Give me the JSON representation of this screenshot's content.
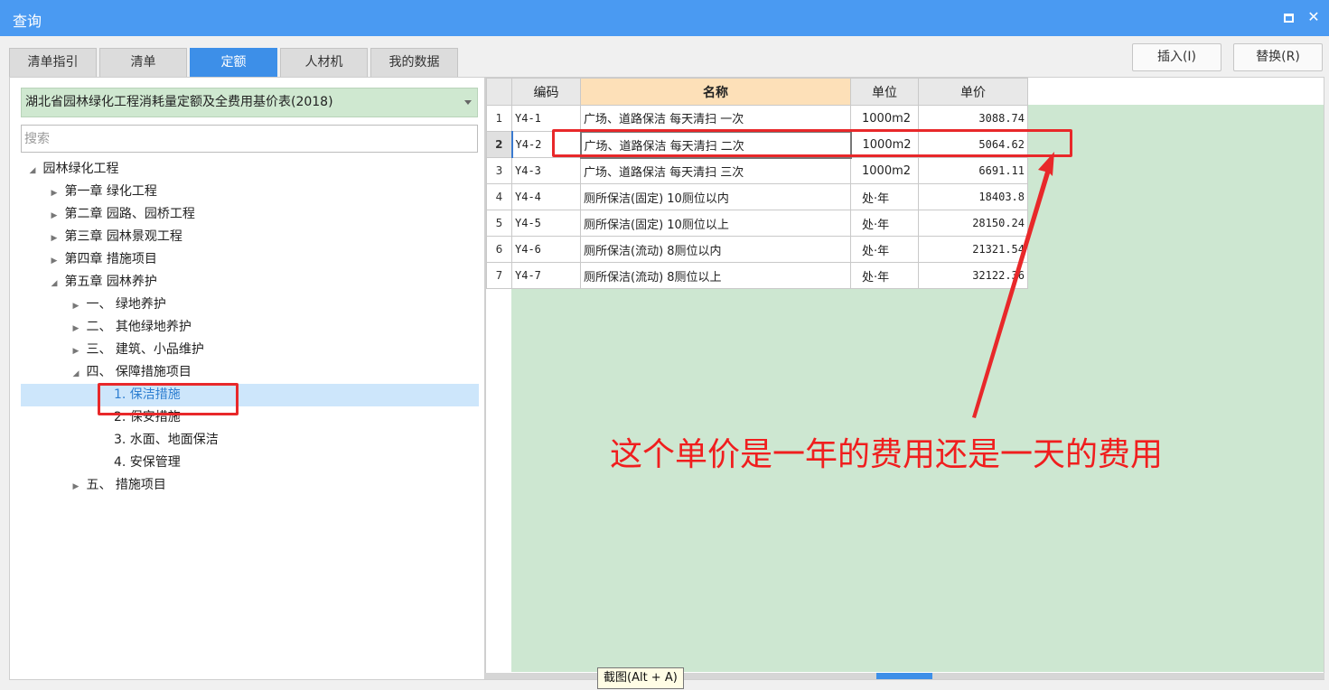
{
  "window": {
    "title": "查询"
  },
  "tabs": [
    {
      "label": "清单指引",
      "active": false
    },
    {
      "label": "清单",
      "active": false
    },
    {
      "label": "定额",
      "active": true
    },
    {
      "label": "人材机",
      "active": false
    },
    {
      "label": "我的数据",
      "active": false
    }
  ],
  "actions": {
    "insert_label": "插入(I)",
    "replace_label": "替换(R)"
  },
  "library": {
    "selected": "湖北省园林绿化工程消耗量定额及全费用基价表(2018)"
  },
  "search": {
    "placeholder": "搜索"
  },
  "tree": [
    {
      "label": "园林绿化工程",
      "expanded": true
    },
    {
      "label": "第一章 绿化工程",
      "expanded": false
    },
    {
      "label": "第二章 园路、园桥工程",
      "expanded": false
    },
    {
      "label": "第三章 园林景观工程",
      "expanded": false
    },
    {
      "label": "第四章 措施项目",
      "expanded": false
    },
    {
      "label": "第五章 园林养护",
      "expanded": true
    },
    {
      "label": "一、  绿地养护",
      "expanded": false
    },
    {
      "label": "二、  其他绿地养护",
      "expanded": false
    },
    {
      "label": "三、  建筑、小品维护",
      "expanded": false
    },
    {
      "label": "四、  保障措施项目",
      "expanded": true
    },
    {
      "label": "1. 保洁措施",
      "selected": true
    },
    {
      "label": "2. 保安措施"
    },
    {
      "label": "3. 水面、地面保洁"
    },
    {
      "label": "4. 安保管理"
    },
    {
      "label": "五、  措施项目",
      "expanded": false
    }
  ],
  "grid": {
    "columns": [
      "编码",
      "名称",
      "单位",
      "单价"
    ],
    "rows": [
      {
        "num": "1",
        "code": "Y4-1",
        "name": "广场、道路保洁 每天清扫 一次",
        "unit": "1000m2",
        "price": "3088.74"
      },
      {
        "num": "2",
        "code": "Y4-2",
        "name": "广场、道路保洁 每天清扫 二次",
        "unit": "1000m2",
        "price": "5064.62"
      },
      {
        "num": "3",
        "code": "Y4-3",
        "name": "广场、道路保洁 每天清扫 三次",
        "unit": "1000m2",
        "price": "6691.11"
      },
      {
        "num": "4",
        "code": "Y4-4",
        "name": "厕所保洁(固定) 10厕位以内",
        "unit": "处·年",
        "price": "18403.8"
      },
      {
        "num": "5",
        "code": "Y4-5",
        "name": "厕所保洁(固定) 10厕位以上",
        "unit": "处·年",
        "price": "28150.24"
      },
      {
        "num": "6",
        "code": "Y4-6",
        "name": "厕所保洁(流动) 8厕位以内",
        "unit": "处·年",
        "price": "21321.54"
      },
      {
        "num": "7",
        "code": "Y4-7",
        "name": "厕所保洁(流动) 8厕位以上",
        "unit": "处·年",
        "price": "32122.36"
      }
    ]
  },
  "tooltip": {
    "text": "截图(Alt + A)"
  },
  "annotation": {
    "text": "这个单价是一年的费用还是一天的费用",
    "color": "#f01e1e"
  }
}
